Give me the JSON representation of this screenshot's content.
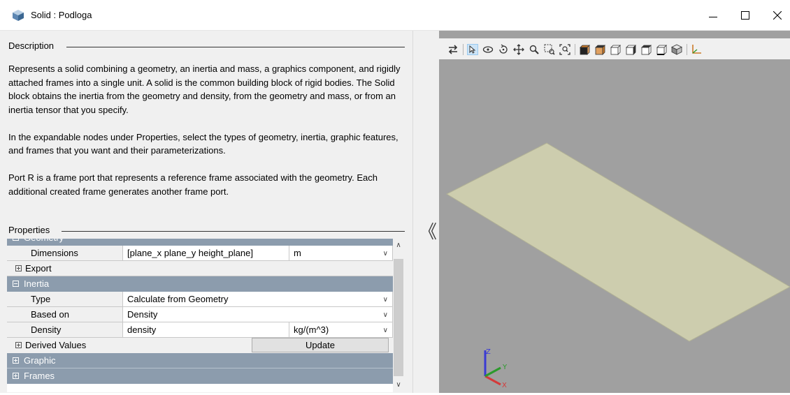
{
  "window": {
    "title": "Solid : Podloga",
    "icons": [
      "solid-block-icon",
      "minimize-icon",
      "maximize-icon",
      "close-icon"
    ]
  },
  "description": {
    "label": "Description",
    "paragraphs": [
      "Represents a solid combining a geometry, an inertia and mass, a graphics component, and rigidly attached frames into a single unit. A solid is the common building block of rigid bodies. The Solid block obtains the inertia from the geometry and density, from the geometry and mass, or from an inertia tensor that you specify.",
      "In the expandable nodes under Properties, select the types of geometry, inertia, graphic features, and frames that you want and their parameterizations.",
      "Port R is a frame port that represents a reference frame associated with the geometry. Each additional created frame generates another frame port."
    ]
  },
  "properties": {
    "label": "Properties",
    "geometry_partial_label": "Geometry",
    "dimensions": {
      "name": "Dimensions",
      "value": "[plane_x plane_y  height_plane]",
      "unit": "m"
    },
    "export": "Export",
    "inertia": "Inertia",
    "type": {
      "name": "Type",
      "value": "Calculate from Geometry"
    },
    "based_on": {
      "name": "Based on",
      "value": "Density"
    },
    "density": {
      "name": "Density",
      "value": "density",
      "unit": "kg/(m^3)"
    },
    "derived_values": "Derived Values",
    "update_button": "Update",
    "graphic": "Graphic",
    "frames": "Frames"
  },
  "splitter": {
    "collapse_glyph": "《"
  },
  "toolbar": {
    "icons": [
      "swap-icon",
      "select-icon",
      "rotate-icon",
      "roll-icon",
      "pan-icon",
      "zoom-icon",
      "zoom-box-icon",
      "fit-to-view-icon",
      "front-view-icon",
      "back-view-icon",
      "left-view-icon",
      "right-view-icon",
      "top-view-icon",
      "bottom-view-icon",
      "isometric-view-icon",
      "frames-toggle-icon"
    ]
  },
  "viewport": {
    "background_color": "#a0a0a0",
    "plane_color": "#cdcdae",
    "triad_labels": {
      "x": "X",
      "y": "Y",
      "z": "Z"
    }
  }
}
